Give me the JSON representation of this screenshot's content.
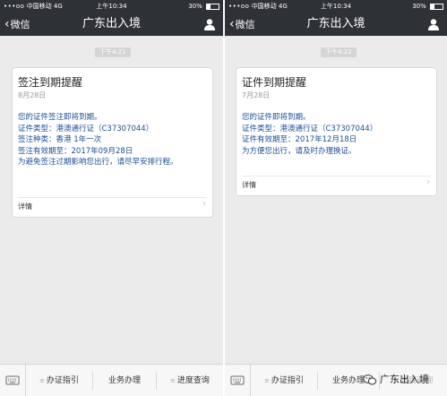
{
  "status_bar": {
    "signal": "•••oo",
    "carrier": "中国移动",
    "network": "4G",
    "time": "上午10:34",
    "battery": "30%",
    "battery_level": 0.3
  },
  "nav": {
    "back_label": "微信",
    "title": "广东出入境"
  },
  "left_screen": {
    "timestamp": "下午4:21",
    "card": {
      "title": "签注到期提醒",
      "date": "8月28日",
      "lines": [
        "您的证件签注即将到期。",
        "证件类型：港澳通行证（C37307044）",
        "签注种类：香港 1年一次",
        "签注有效期至：2017年09月28日",
        "为避免签注过期影响您出行，请尽早安排行程。"
      ],
      "details_label": "详情"
    },
    "menu": [
      "办证指引",
      "业务办理",
      "进度查询"
    ]
  },
  "right_screen": {
    "timestamp": "下午4:22",
    "card": {
      "title": "证件到期提醒",
      "date": "7月28日",
      "lines": [
        "您的证件即将到期。",
        "证件类型：港澳通行证（C37307044）",
        "证件有效期至：2017年12月18日",
        "为方便您出行，请及时办理换证。"
      ],
      "details_label": "详情"
    },
    "menu": [
      "办证指引",
      "业务办理",
      "进度查询"
    ],
    "watermark": "广东出入境"
  },
  "colors": {
    "nav_bg": "#2e3135",
    "chat_bg": "#ebebeb",
    "body_text": "#1e4f96"
  },
  "icons": {
    "user": "person-icon",
    "keyboard": "keyboard-icon",
    "menu_lines": "menu-lines-icon",
    "chevron": "chevron-right-icon"
  }
}
